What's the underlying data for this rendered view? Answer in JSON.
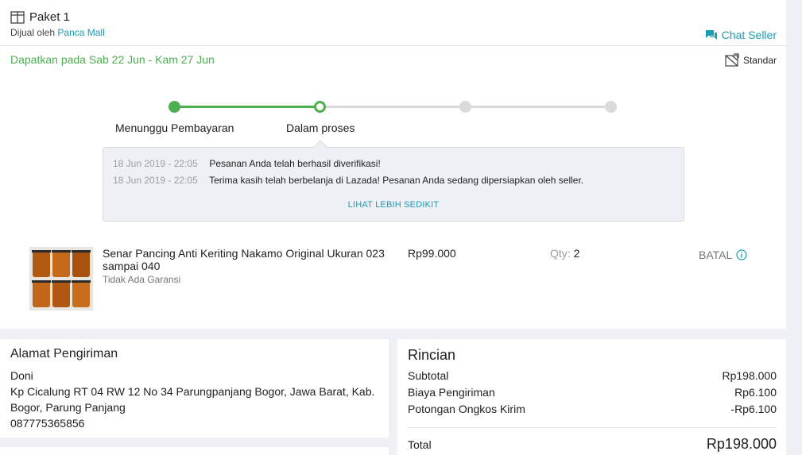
{
  "package": {
    "title": "Paket 1",
    "sold_by_prefix": "Dijual oleh",
    "seller_name": "Panca Mall",
    "chat_label": "Chat Seller",
    "delivery_estimate": "Dapatkan pada Sab 22 Jun - Kam 27 Jun",
    "shipping_type": "Standar"
  },
  "tracker": {
    "steps": [
      {
        "label": "Menunggu Pembayaran",
        "state": "done"
      },
      {
        "label": "Dalam proses",
        "state": "current"
      },
      {
        "label": "",
        "state": "pending"
      },
      {
        "label": "",
        "state": "pending"
      }
    ]
  },
  "history": {
    "entries": [
      {
        "time": "18 Jun 2019 - 22:05",
        "message": "Pesanan Anda telah berhasil diverifikasi!"
      },
      {
        "time": "18 Jun 2019 - 22:05",
        "message": "Terima kasih telah berbelanja di Lazada! Pesanan Anda sedang dipersiapkan oleh seller."
      }
    ],
    "toggle_label": "LIHAT LEBIH SEDIKIT"
  },
  "item": {
    "name": "Senar Pancing Anti Keriting Nakamo Original Ukuran 023 sampai 040",
    "warranty": "Tidak Ada Garansi",
    "price": "Rp99.000",
    "qty_label": "Qty:",
    "qty_value": "2",
    "status": "BATAL"
  },
  "address": {
    "title": "Alamat Pengiriman",
    "name": "Doni",
    "line": "Kp Cicalung RT 04 RW 12 No 34 Parungpanjang Bogor, Jawa Barat, Kab. Bogor, Parung Panjang",
    "phone": "087775365856"
  },
  "summary": {
    "title": "Rincian",
    "rows": [
      {
        "label": "Subtotal",
        "value": "Rp198.000"
      },
      {
        "label": "Biaya Pengiriman",
        "value": "Rp6.100"
      },
      {
        "label": "Potongan Ongkos Kirim",
        "value": "-Rp6.100"
      }
    ],
    "total_label": "Total",
    "total_value": "Rp198.000"
  },
  "colors": {
    "accent": "#1a9cb7",
    "success": "#4caf50",
    "pending": "#dadada"
  }
}
